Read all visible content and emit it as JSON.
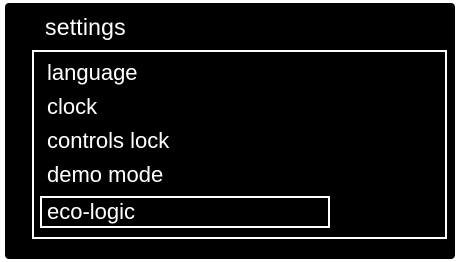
{
  "header": {
    "title": "settings"
  },
  "menu": {
    "selected_index": 4,
    "items": [
      {
        "label": "language"
      },
      {
        "label": "clock"
      },
      {
        "label": "controls lock"
      },
      {
        "label": "demo mode"
      },
      {
        "label": "eco-logic"
      }
    ]
  },
  "colors": {
    "background": "#000000",
    "foreground": "#ffffff"
  }
}
